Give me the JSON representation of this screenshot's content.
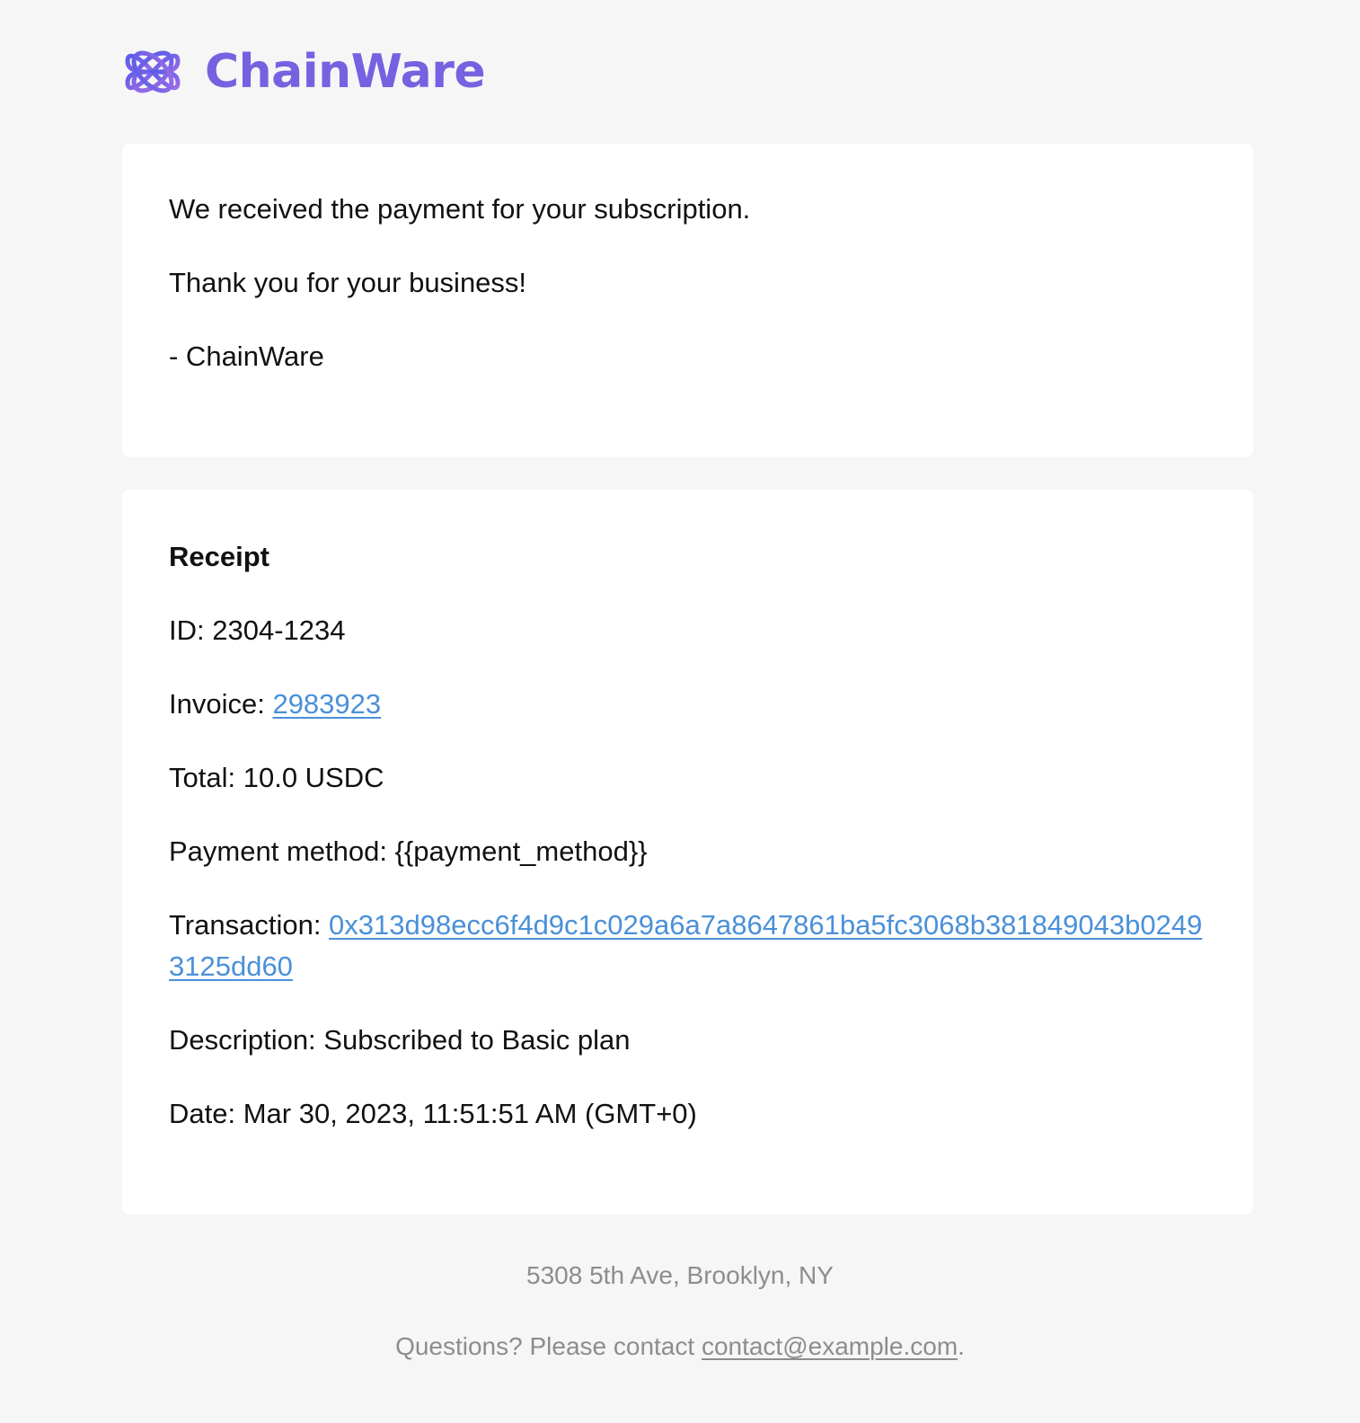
{
  "brand": {
    "name": "ChainWare",
    "logo_icon": "interlocking-loops-logo-icon",
    "color": "#7462e0"
  },
  "message": {
    "line1": "We received the payment for your subscription.",
    "line2": "Thank you for your business!",
    "signature": "- ChainWare"
  },
  "receipt": {
    "heading": "Receipt",
    "id_label": "ID: ",
    "id_value": "2304-1234",
    "invoice_label": "Invoice: ",
    "invoice_value": "2983923",
    "total_label": "Total: ",
    "total_value": "10.0 USDC",
    "payment_method_label": "Payment method: ",
    "payment_method_value": "{{payment_method}}",
    "transaction_label": "Transaction: ",
    "transaction_value": "0x313d98ecc6f4d9c1c029a6a7a8647861ba5fc3068b381849043b02493125dd60",
    "description_label": "Description: ",
    "description_value": "Subscribed to Basic plan",
    "date_label": "Date: ",
    "date_value": "Mar 30, 2023, 11:51:51 AM (GMT+0)"
  },
  "footer": {
    "address": "5308 5th Ave, Brooklyn, NY",
    "contact_prefix": "Questions? Please contact ",
    "contact_email": "contact@example.com",
    "contact_suffix": "."
  },
  "colors": {
    "link": "#4a90d9",
    "footer_text": "#8d8d8d",
    "background": "#f6f6f6"
  }
}
